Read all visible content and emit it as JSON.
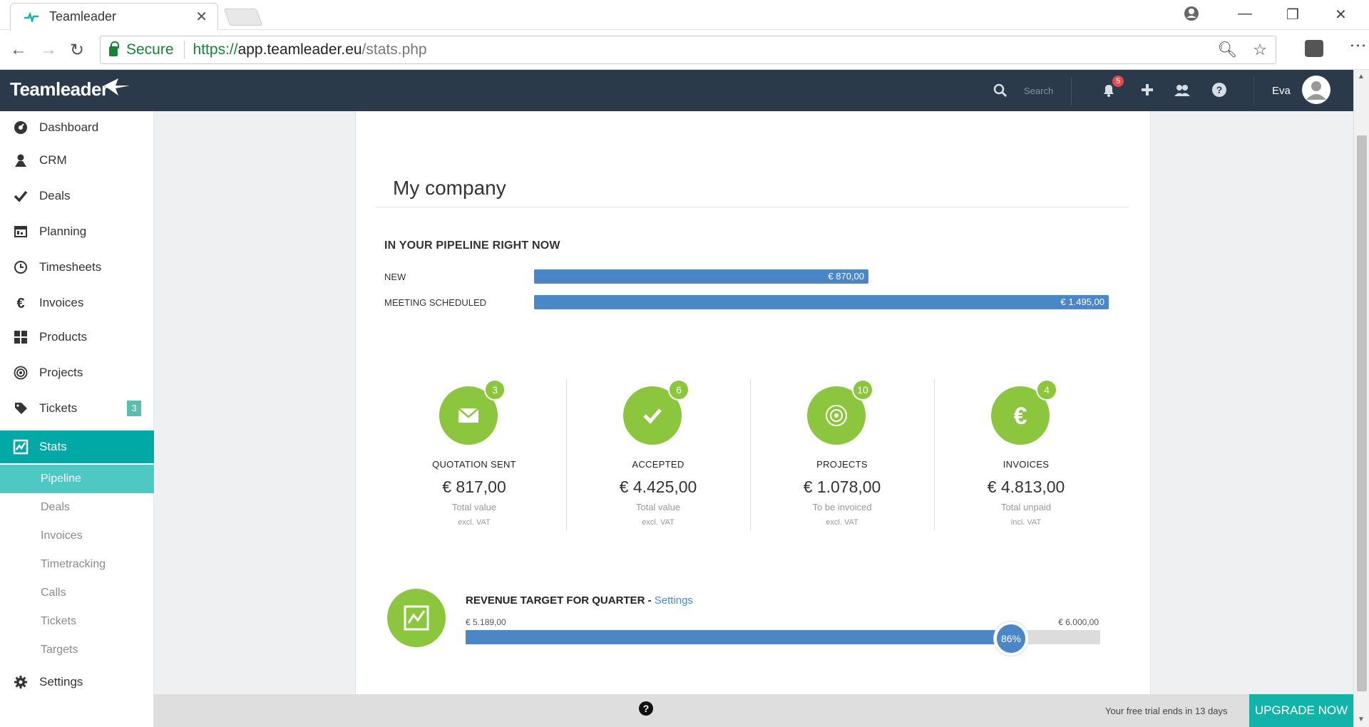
{
  "browser": {
    "tab_title": "Teamleader",
    "secure_label": "Secure",
    "url_scheme": "https://",
    "url_host": "app.teamleader.eu",
    "url_path": "/stats.php"
  },
  "header": {
    "logo_text": "Teamleader",
    "search_placeholder": "Search",
    "notification_count": "5",
    "user_name": "Eva"
  },
  "sidebar": {
    "items": [
      {
        "label": "Dashboard",
        "icon": "dashboard-icon"
      },
      {
        "label": "CRM",
        "icon": "person-icon"
      },
      {
        "label": "Deals",
        "icon": "checkmark-icon"
      },
      {
        "label": "Planning",
        "icon": "calendar-icon"
      },
      {
        "label": "Timesheets",
        "icon": "clock-icon"
      },
      {
        "label": "Invoices",
        "icon": "euro-icon"
      },
      {
        "label": "Products",
        "icon": "grid-icon"
      },
      {
        "label": "Projects",
        "icon": "target-icon"
      },
      {
        "label": "Tickets",
        "icon": "tag-icon",
        "badge": "3"
      },
      {
        "label": "Stats",
        "icon": "chart-icon"
      }
    ],
    "sub_items": [
      "Pipeline",
      "Deals",
      "Invoices",
      "Timetracking",
      "Calls",
      "Tickets",
      "Targets"
    ],
    "settings_label": "Settings"
  },
  "main": {
    "title": "My company",
    "pipeline_heading": "IN YOUR PIPELINE RIGHT NOW",
    "pipeline": [
      {
        "label": "NEW",
        "value_text": "€ 870,00",
        "value": 870.0
      },
      {
        "label": "MEETING SCHEDULED",
        "value_text": "€ 1.495,00",
        "value": 1495.0
      }
    ],
    "kpis": [
      {
        "title": "QUOTATION SENT",
        "count": "3",
        "amount": "€ 817,00",
        "sub": "Total value",
        "note": "excl. VAT",
        "icon": "envelope-icon"
      },
      {
        "title": "ACCEPTED",
        "count": "6",
        "amount": "€ 4.425,00",
        "sub": "Total value",
        "note": "excl. VAT",
        "icon": "checkmark-icon"
      },
      {
        "title": "PROJECTS",
        "count": "10",
        "amount": "€ 1.078,00",
        "sub": "To be invoiced",
        "note": "excl. VAT",
        "icon": "target-icon"
      },
      {
        "title": "INVOICES",
        "count": "4",
        "amount": "€ 4.813,00",
        "sub": "Total unpaid",
        "note": "incl. VAT",
        "icon": "euro-icon"
      }
    ],
    "revenue": {
      "title": "REVENUE TARGET FOR QUARTER - ",
      "settings_link": "Settings",
      "current": "€ 5.189,00",
      "target": "€ 6.000,00",
      "percent_label": "86%",
      "fraction": 0.86
    }
  },
  "footer": {
    "help": "?",
    "trial_text": "Your free trial ends in 13 days",
    "upgrade_label": "UPGRADE NOW"
  },
  "colors": {
    "header_bg": "#2b3a4a",
    "accent_teal": "#00a9a5",
    "kpi_green": "#8cc63f",
    "bar_blue": "#4b86c7"
  }
}
